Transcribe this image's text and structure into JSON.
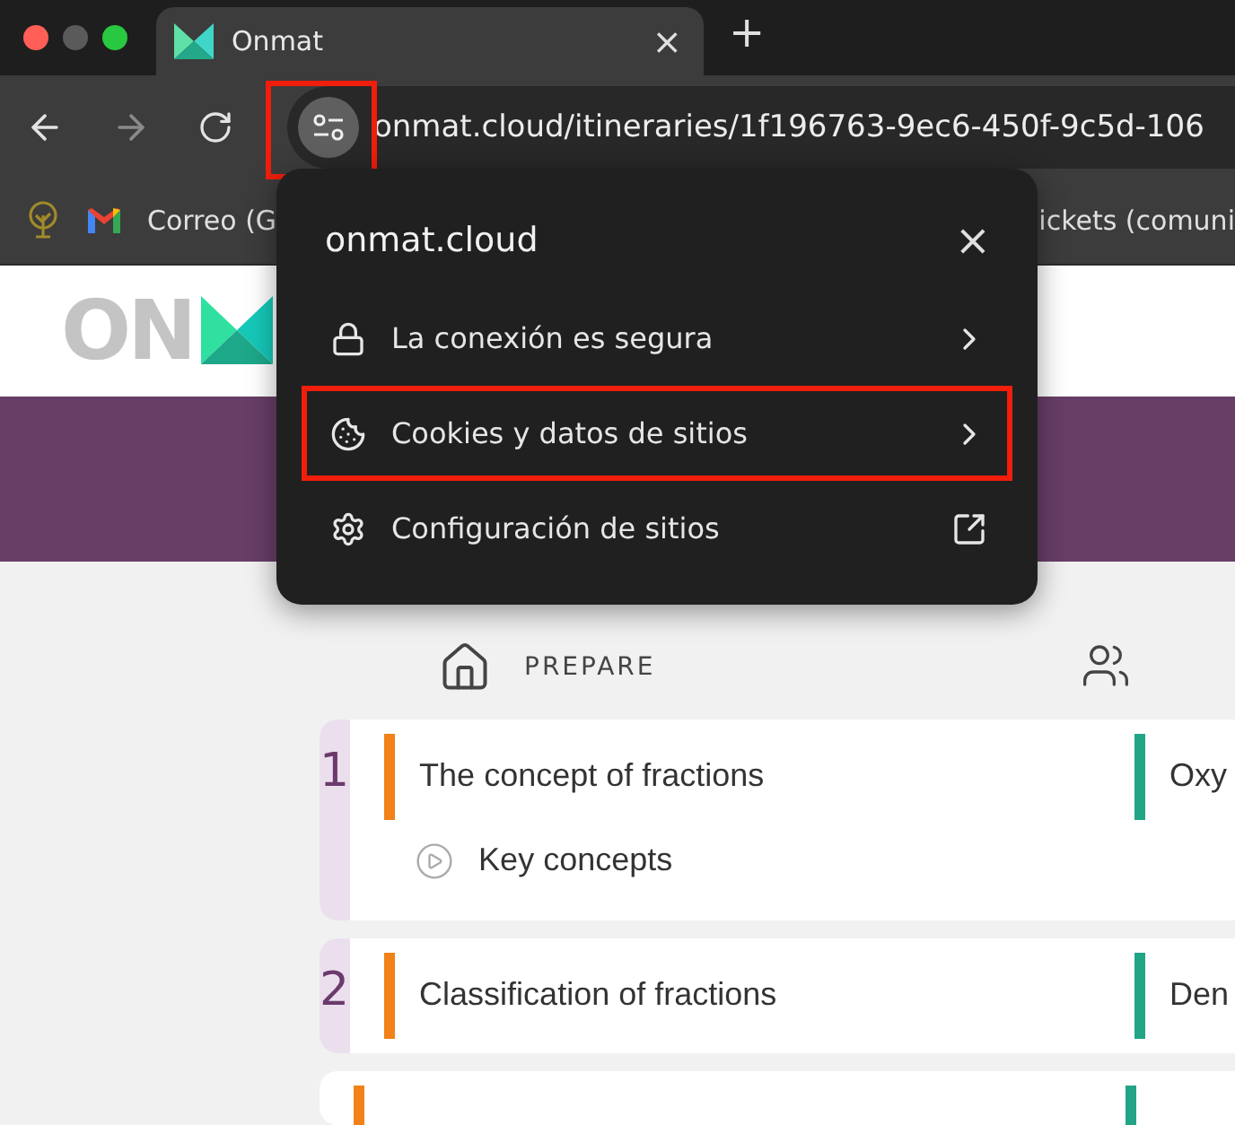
{
  "window": {
    "controls": [
      {
        "color": "#ff5f57"
      },
      {
        "color": "#5a5a5a"
      },
      {
        "color": "#28c840"
      }
    ]
  },
  "tabs": [
    {
      "title": "Onmat",
      "selected": true,
      "close": "×"
    }
  ],
  "new_tab": "+",
  "address_bar": {
    "url": "onmat.cloud/itineraries/1f196763-9ec6-450f-9c5d-106",
    "site_info_highlighted": true
  },
  "bookmarks": [
    {
      "kind": "tree"
    },
    {
      "kind": "mail",
      "label": "Correo (G"
    },
    {
      "kind": "plain",
      "label": "ickets (comuni"
    }
  ],
  "page": {
    "logo": "ON",
    "column_header": "PREPARE",
    "rows": [
      {
        "kind": "full",
        "number": "1",
        "title": "The concept of fractions",
        "subitem": "Key concepts",
        "column_2": "Oxy"
      },
      {
        "kind": "full",
        "number": "2",
        "title": "Classification of fractions",
        "column_2": "Den"
      },
      {
        "kind": "cut"
      }
    ]
  },
  "popup": {
    "title": "onmat.cloud",
    "close": "×",
    "items": [
      {
        "kind": "lock",
        "label": "La conexión es segura",
        "highlighted": false
      },
      {
        "kind": "cookie",
        "label": "Cookies y datos de sitios",
        "highlighted": true
      },
      {
        "kind": "gear",
        "label": "Configuración de sitios",
        "highlighted": false
      }
    ]
  }
}
